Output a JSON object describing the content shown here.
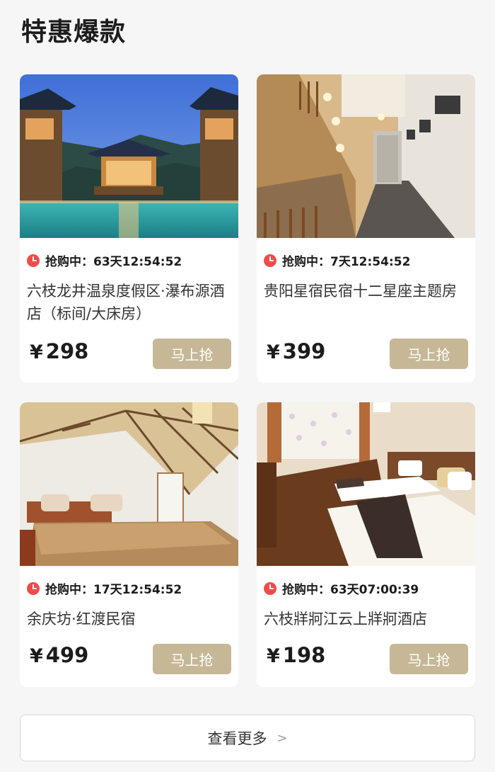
{
  "section": {
    "title": "特惠爆款"
  },
  "products": [
    {
      "timer_label": "抢购中：",
      "countdown": "63天12:54:52",
      "name": "六枝龙井温泉度假区·瀑布源酒店（标间/大床房）",
      "currency": "¥",
      "price": "298",
      "button": "马上抢",
      "image_icon": "resort-pavilion-pool-photo"
    },
    {
      "timer_label": "抢购中：",
      "countdown": "7天12:54:52",
      "name": "贵阳星宿民宿十二星座主题房",
      "currency": "¥",
      "price": "399",
      "button": "马上抢",
      "image_icon": "hallway-staircase-photo"
    },
    {
      "timer_label": "抢购中：",
      "countdown": "17天12:54:52",
      "name": "余庆坊·红渡民宿",
      "currency": "¥",
      "price": "499",
      "button": "马上抢",
      "image_icon": "attic-bedroom-photo"
    },
    {
      "timer_label": "抢购中：",
      "countdown": "63天07:00:39",
      "name": "六枝牂牁江云上牂牁酒店",
      "currency": "¥",
      "price": "198",
      "button": "马上抢",
      "image_icon": "twin-bed-room-photo"
    }
  ],
  "more": {
    "label": "查看更多",
    "arrow": ">"
  },
  "colors": {
    "accent_button": "#c6b796",
    "clock_red": "#ee4c4c"
  }
}
